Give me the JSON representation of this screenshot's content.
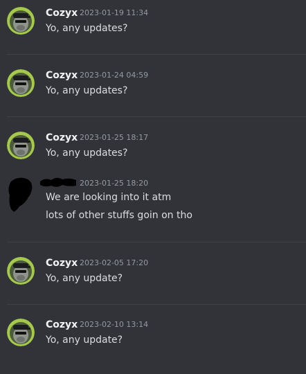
{
  "messages": [
    {
      "author": "Cozyx",
      "timestamp": "2023-01-19 11:34",
      "lines": [
        "Yo, any updates?"
      ]
    },
    {
      "author": "Cozyx",
      "timestamp": "2023-01-24 04:59",
      "lines": [
        "Yo, any updates?"
      ]
    },
    {
      "author": "Cozyx",
      "timestamp": "2023-01-25 18:17",
      "lines": [
        "Yo, any updates?"
      ]
    },
    {
      "author": "",
      "timestamp": "2023-01-25 18:20",
      "lines": [
        "We are looking into it atm",
        "lots of other stuffs goin on tho"
      ]
    },
    {
      "author": "Cozyx",
      "timestamp": "2023-02-05 17:20",
      "lines": [
        "Yo, any update?"
      ]
    },
    {
      "author": "Cozyx",
      "timestamp": "2023-02-10 13:14",
      "lines": [
        "Yo, any update?"
      ]
    }
  ],
  "colors": {
    "background": "#313338",
    "author": "#f2f3f5",
    "timestamp": "#949ba4",
    "message_text": "#dbdee1",
    "avatar_ring": "#a5c94a"
  },
  "icons": {
    "user_avatar": "gorilla-with-cap-avatar-icon",
    "redacted_avatar": "scribbled-out-avatar-icon"
  }
}
